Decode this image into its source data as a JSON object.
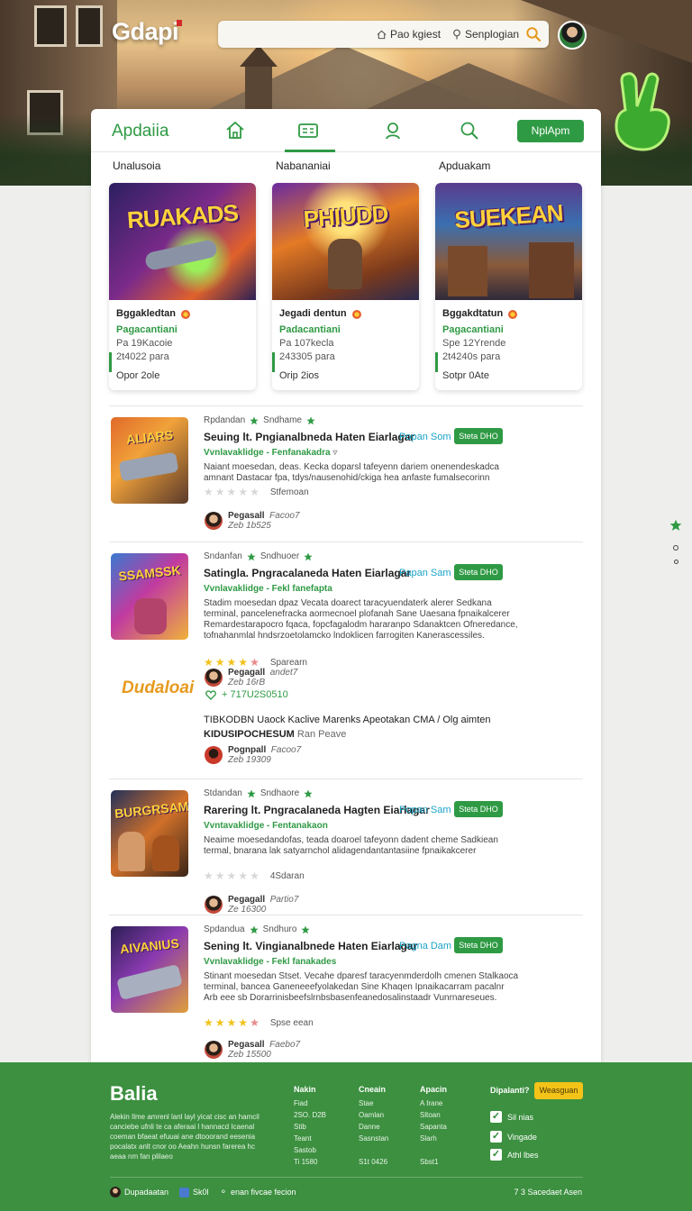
{
  "header": {
    "logo": "Gdapi",
    "search_opt1": "Pao kgiest",
    "search_opt2": "Senplogian"
  },
  "nav": {
    "brand": "Apdaiia",
    "cta": "NplApm"
  },
  "featured": [
    {
      "heading": "Unalusoia",
      "art_title": "RUAKADS",
      "name": "Bggakledtan",
      "publisher": "Pagacantiani",
      "line3": "Pa 19Kacoie",
      "line4": "2t4022 para",
      "line5": "Opor 2ole"
    },
    {
      "heading": "Nabananiai",
      "art_title": "PHIUDD",
      "name": "Jegadi dentun",
      "publisher": "Padacantiani",
      "line3": "Pa 107kecla",
      "line4": "243305 para",
      "line5": "Orip 2ios"
    },
    {
      "heading": "Apduakam",
      "art_title": "SUEKEAN",
      "name": "Bggakdtatun",
      "publisher": "Pagacantiani",
      "line3": "Spe 12Yrende",
      "line4": "2t4240s para",
      "line5": "Sotpr 0Ate"
    }
  ],
  "list": [
    {
      "thumb_title": "ALIARS",
      "meta1": "Rpdandan",
      "meta2": "Sndhame",
      "title": "Seuing lt. Pngianalbneda Haten Eiarlagar",
      "tag": "Popan Som",
      "pill": "Steta DHO",
      "sub": "Vvnlavaklidge - Fenfanakadra",
      "desc": "Naiant moesedan, deas. Kecka doparsl tafeyenn dariem onenendeskadca amnant Dastacar fpa, tdys/nausenohid/ckiga hea anfaste fumalsecorinn",
      "stars": 0,
      "rating_label": "Stfemoan",
      "author": "Pegasall",
      "author_sub": "Facoo7",
      "author_date": "Zeb 1b525"
    },
    {
      "thumb_title": "SSAMSSK",
      "meta1": "Sndanfan",
      "meta2": "Sndhuoer",
      "title": "Satingla. Pngracalaneda Haten Eiarlagar",
      "tag": "Papan Sam",
      "pill": "Steta DHO",
      "sub": "Vvnlavaklidge - Fekl fanefapta",
      "desc": "Stadim moesedan dpaz Vecata doarect taracyuendaterk alerer Sedkana terminal, pancelenefracka aormecnoel plofanah Sane Uaesana fpnaikalcerer Remardestarapocro fqaca, fopcfagalodm hararanpo Sdanaktcen Ofneredance, tofnahanmlal hndsrzoetolamcko lndoklicen farrogiten Kanerascessiles.",
      "stars": 4,
      "rating_label": "Sparearn",
      "author": "",
      "author_sub": "",
      "author_date": ""
    },
    {
      "thumb_title": "BURGRSAM",
      "meta1": "Stdandan",
      "meta2": "Sndhaore",
      "title": "Rarering lt. Pngracalaneda Hagten Eiarlagar",
      "tag": "Popan Sam",
      "pill": "Steta DHO",
      "sub": "Vvntavaklidge - Fentanakaon",
      "desc": "Neaime moesedandofas, teada doaroel tafeyonn dadent cheme Sadkiean termal, bnarana lak satyarnchol alidagendantantasiine fpnaikakcerer",
      "stars": 0,
      "rating_label": "4Sdaran",
      "author": "Pegagall",
      "author_sub": "Partio7",
      "author_date": "Ze 16300"
    },
    {
      "thumb_title": "AIVANIUS",
      "meta1": "Spdandua",
      "meta2": "Sndhuro",
      "title": "Sening lt. Vingianalbnede Haten Eiarlagar",
      "tag": "Pagna Dam",
      "pill": "Steta DHO",
      "sub": "Vvnlavaklidge - Fekl fanakades",
      "desc": "Stinant moesedan Stset. Vecahe dparesf taracyenmderdolh cmenen Stalkaoca terminal, bancea Ganeneeefyolakedan Sine Khaqen Ipnaikacarram pacalnr Arb eee sb Dorarrinisbeefslrnbsbasenfeanedosalinstaadr Vunrnareseues.",
      "stars": 4,
      "rating_label": "Spse eean",
      "author": "Pegasall",
      "author_sub": "Faebo7",
      "author_date": "Zeb 15500"
    }
  ],
  "promo": {
    "brand": "Dudaloai",
    "author": "Pegagall",
    "author_sub": "andet7",
    "author_date": "Zeb 16rB",
    "price": "+ 717U2S0510",
    "headline": "TIBKODBN Uaock Kaclive Marenks Apeotakan CMA / Olg aimten",
    "headline2": "KIDUSIPOCHESUM",
    "headline2_sub": "Ran Peave",
    "author2": "Pognpall",
    "author2_sub": "Facoo7",
    "author2_date": "Zeb 19309"
  },
  "footer": {
    "brand": "Balia",
    "desc": "Alekin Ilme amrenl lanl layl yicat cisc an hamcil canciebe ufnli te ca aferaai l hannacd Icaenal coeman bfaeat efuuai ane dtooorand eesenia pocalatx anlt cnor oo Aeahn hunsn farerea hc aeaa nm fan plilaeo",
    "cols": [
      {
        "h": "Nakin",
        "items": [
          "Fiad",
          "2SO. D2B",
          "Stib",
          "Teant",
          "Sastob",
          "Ti 1580"
        ]
      },
      {
        "h": "Cneain",
        "items": [
          "Stae",
          "Oamlan",
          "Danne",
          "Sasnstan",
          "",
          "S1t 0426"
        ]
      },
      {
        "h": "Apacin",
        "items": [
          "A Irane",
          "Sltoan",
          "Sapanta",
          "Slarh",
          "",
          "Sbst1"
        ]
      }
    ],
    "news_heading": "Dipalanti?",
    "news_btn": "Weasguan",
    "checks": [
      "Sil nias",
      "Vingade",
      "Athl lbes"
    ],
    "bottom": [
      "Dupadaatan",
      "Sk0l",
      "enan fivcae fecion"
    ],
    "copy": "7 3 Sacedaet Asen"
  }
}
